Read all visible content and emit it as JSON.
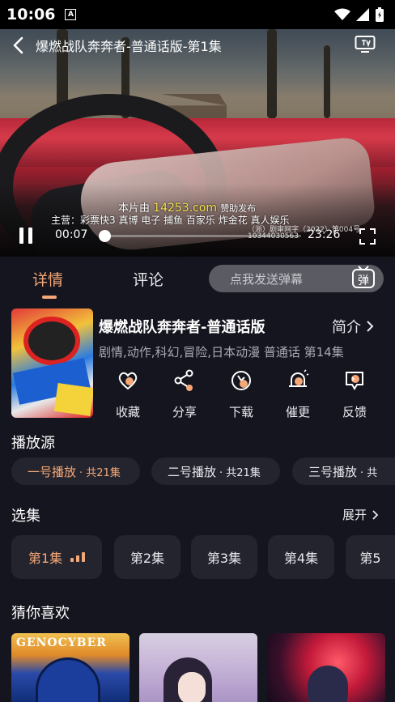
{
  "status_bar": {
    "time": "10:06",
    "notification_icon": "A"
  },
  "player": {
    "title": "爆燃战队奔奔者-普通话版-第1集",
    "sponsor_prefix": "本片由",
    "sponsor_site": "14253.com",
    "sponsor_suffix": "赞助发布",
    "ticker": "主营：彩票快3 真博 电子 捕鱼 百家乐 炸金花 真人娱乐",
    "license_line1": "（浙）剧审网字（2022）第004号",
    "license_line2": "10344030563",
    "current_time": "00:07",
    "total_time": "23:26",
    "progress": 0.005
  },
  "tabs": {
    "items": [
      {
        "label": "详情"
      },
      {
        "label": "评论"
      }
    ],
    "danmu_placeholder": "点我发送弹幕",
    "danmu_badge": "弹"
  },
  "show": {
    "title": "爆燃战队奔奔者-普通话版",
    "intro_label": "简介",
    "tags": "剧情,动作,科幻,冒险,日本动漫 普通话 第14集"
  },
  "actions": [
    {
      "label": "收藏",
      "icon": "heart-icon"
    },
    {
      "label": "分享",
      "icon": "share-icon"
    },
    {
      "label": "下载",
      "icon": "download-icon"
    },
    {
      "label": "催更",
      "icon": "bell-icon"
    },
    {
      "label": "反馈",
      "icon": "feedback-icon"
    }
  ],
  "sources": {
    "title": "播放源",
    "items": [
      {
        "label": "一号播放",
        "count": "· 共21集"
      },
      {
        "label": "二号播放",
        "count": "· 共21集"
      },
      {
        "label": "三号播放",
        "count": "· 共"
      }
    ]
  },
  "episodes": {
    "title": "选集",
    "expand_label": "展开",
    "items": [
      {
        "label": "第1集"
      },
      {
        "label": "第2集"
      },
      {
        "label": "第3集"
      },
      {
        "label": "第4集"
      },
      {
        "label": "第5"
      }
    ]
  },
  "recommend": {
    "title": "猜你喜欢",
    "items": [
      {
        "label": "GENOCYBER"
      }
    ]
  },
  "colors": {
    "accent": "#f5a877",
    "background": "#15151f",
    "chip": "#24242e"
  }
}
